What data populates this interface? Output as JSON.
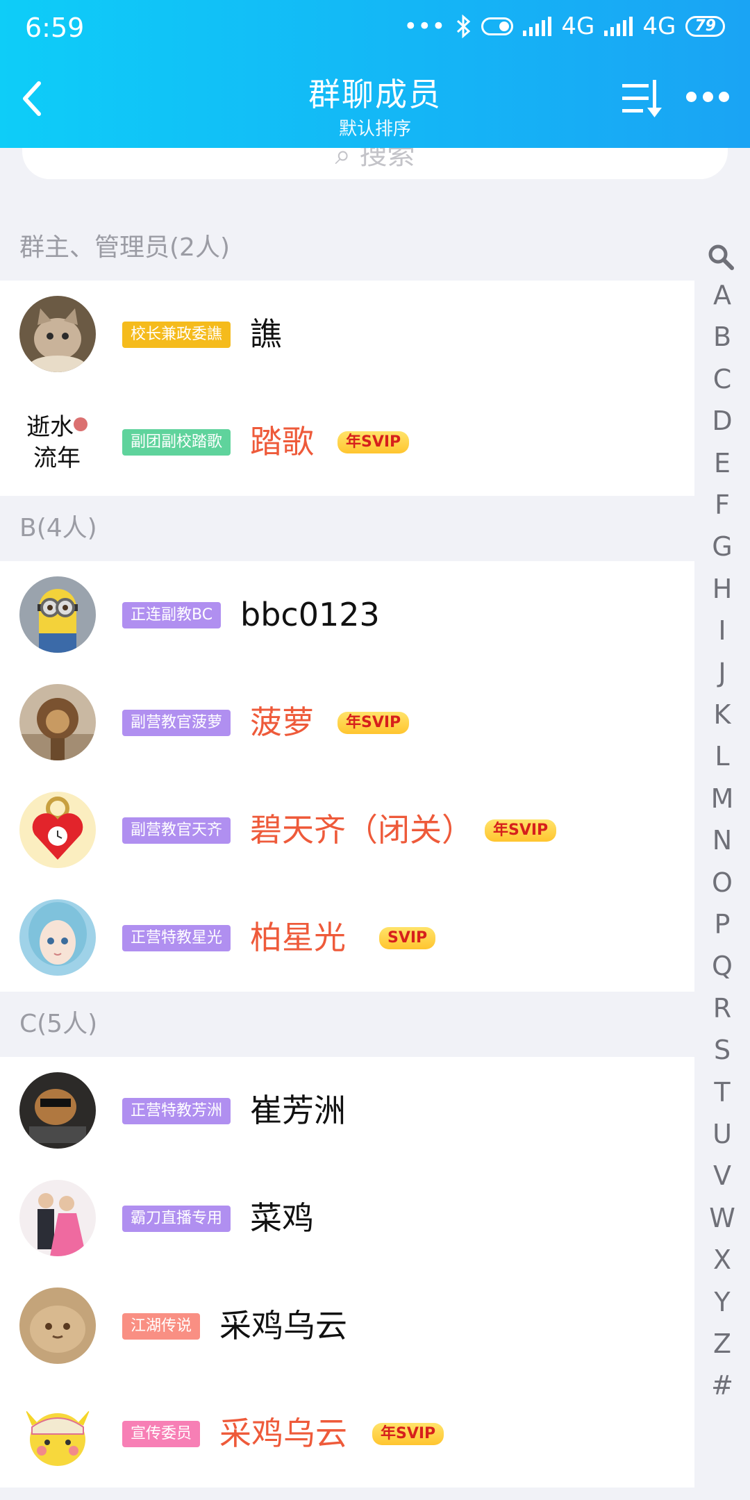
{
  "status_bar": {
    "time": "6:59",
    "network1": "4G",
    "network2": "4G",
    "battery": "79"
  },
  "header": {
    "title": "群聊成员",
    "subtitle": "默认排序"
  },
  "search": {
    "placeholder": "搜索"
  },
  "sections": [
    {
      "label": "群主、管理员(2人)"
    },
    {
      "label": "B(4人)"
    },
    {
      "label": "C(5人)"
    }
  ],
  "members": [
    {
      "tag": "校长兼政委譙",
      "tag_color": "#f5bb1c",
      "name": "譙",
      "vip": "",
      "name_color": "#111111",
      "avatar": "cat"
    },
    {
      "tag": "副团副校踏歌",
      "tag_color": "#5fd39c",
      "name": "踏歌",
      "vip": "年SVIP",
      "name_color": "#ee5a3a",
      "avatar": "calligraphy"
    },
    {
      "tag": "正连副教BC",
      "tag_color": "#b08ff0",
      "name": "bbc0123",
      "vip": "",
      "name_color": "#111111",
      "avatar": "minion"
    },
    {
      "tag": "副营教官菠萝",
      "tag_color": "#b08ff0",
      "name": "菠萝",
      "vip": "年SVIP",
      "name_color": "#ee5a3a",
      "avatar": "lion"
    },
    {
      "tag": "副营教官天齐",
      "tag_color": "#b08ff0",
      "name": "碧天齐（闭关）",
      "vip": "年SVIP",
      "name_color": "#ee5a3a",
      "avatar": "heart-lock"
    },
    {
      "tag": "正营特教星光",
      "tag_color": "#b08ff0",
      "name": "柏星光",
      "vip": "SVIP",
      "name_color": "#ee5a3a",
      "avatar": "anime-girl"
    },
    {
      "tag": "正营特教芳洲",
      "tag_color": "#b08ff0",
      "name": "崔芳洲",
      "vip": "",
      "name_color": "#111111",
      "avatar": "dog"
    },
    {
      "tag": "霸刀直播专用",
      "tag_color": "#b08ff0",
      "name": "菜鸡",
      "vip": "",
      "name_color": "#111111",
      "avatar": "couple"
    },
    {
      "tag": "江湖传说",
      "tag_color": "#f98f83",
      "name": "采鸡乌云",
      "vip": "",
      "name_color": "#111111",
      "avatar": "cat2"
    },
    {
      "tag": "宣传委员",
      "tag_color": "#f77fb5",
      "name": "采鸡乌云",
      "vip": "年SVIP",
      "name_color": "#ee5a3a",
      "avatar": "pikachu"
    }
  ],
  "index_letters": [
    "A",
    "B",
    "C",
    "D",
    "E",
    "F",
    "G",
    "H",
    "I",
    "J",
    "K",
    "L",
    "M",
    "N",
    "O",
    "P",
    "Q",
    "R",
    "S",
    "T",
    "U",
    "V",
    "W",
    "X",
    "Y",
    "Z",
    "#"
  ]
}
